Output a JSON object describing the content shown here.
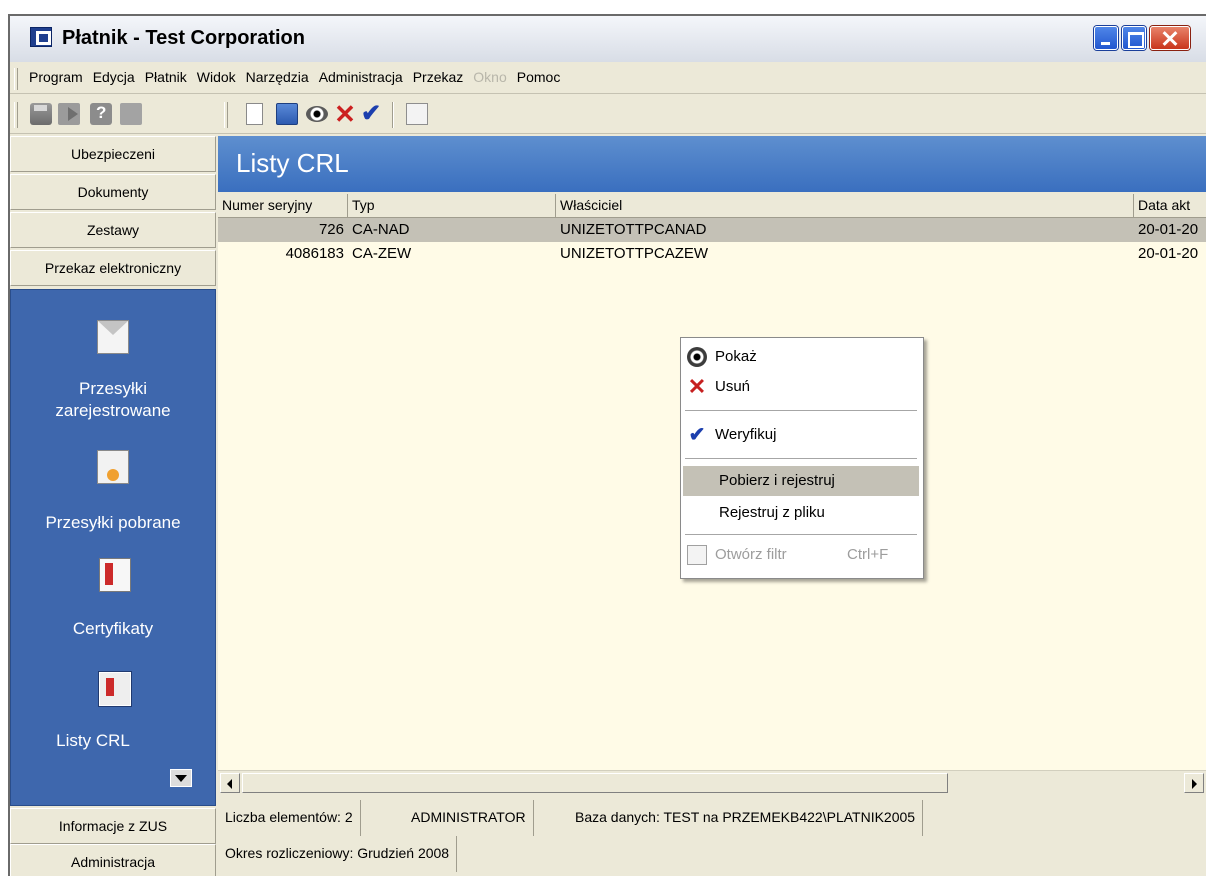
{
  "window": {
    "title": "Płatnik - Test Corporation"
  },
  "menubar": {
    "items": [
      {
        "label": "Program",
        "enabled": true
      },
      {
        "label": "Edycja",
        "enabled": true
      },
      {
        "label": "Płatnik",
        "enabled": true
      },
      {
        "label": "Widok",
        "enabled": true
      },
      {
        "label": "Narzędzia",
        "enabled": true
      },
      {
        "label": "Administracja",
        "enabled": true
      },
      {
        "label": "Przekaz",
        "enabled": true
      },
      {
        "label": "Okno",
        "enabled": false
      },
      {
        "label": "Pomoc",
        "enabled": true
      }
    ]
  },
  "sidebar": {
    "top_tabs": [
      "Ubezpieczeni",
      "Dokumenty",
      "Zestawy",
      "Przekaz elektroniczny"
    ],
    "panel_items": [
      {
        "label": "Przesyłki zarejestrowane",
        "icon": "envelope-doc-icon"
      },
      {
        "label": "Przesyłki pobrane",
        "icon": "envelope-download-icon"
      },
      {
        "label": "Certyfikaty",
        "icon": "certificate-icon"
      },
      {
        "label": "Listy CRL",
        "icon": "crl-list-icon"
      }
    ],
    "bottom_tabs": [
      "Informacje z ZUS",
      "Administracja"
    ]
  },
  "main": {
    "header_title": "Listy CRL",
    "columns": [
      "Numer seryjny",
      "Typ",
      "Właściciel",
      "Data akt"
    ],
    "rows": [
      {
        "serial": "726",
        "type": "CA-NAD",
        "owner": "UNIZETOTTPCANAD",
        "date": "20-01-20",
        "selected": true
      },
      {
        "serial": "4086183",
        "type": "CA-ZEW",
        "owner": "UNIZETOTTPCAZEW",
        "date": "20-01-20",
        "selected": false
      }
    ]
  },
  "statusbar": {
    "count": "Liczba elementów: 2",
    "user": "ADMINISTRATOR",
    "database": "Baza danych: TEST na PRZEMEKB422\\PLATNIK2005",
    "period": "Okres rozliczeniowy: Grudzień 2008"
  },
  "context_menu": {
    "items": [
      {
        "label": "Pokaż",
        "icon": "eye-icon"
      },
      {
        "label": "Usuń",
        "icon": "delete-x-icon"
      },
      {
        "label": "Weryfikuj",
        "icon": "checkmark-icon"
      },
      {
        "label": "Pobierz i rejestruj",
        "highlighted": true
      },
      {
        "label": "Rejestruj z pliku"
      },
      {
        "label": "Otwórz filtr",
        "shortcut": "Ctrl+F",
        "disabled": true,
        "icon": "filter-icon"
      }
    ]
  },
  "colors": {
    "panel_blue": "#3e67ad",
    "header_blue": "#3a6fbf",
    "list_background": "#fffbe7",
    "selection": "#c4c1b6"
  }
}
